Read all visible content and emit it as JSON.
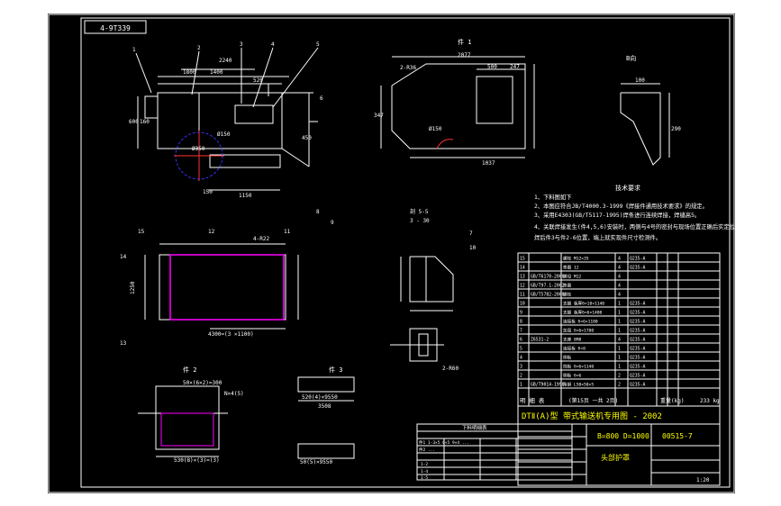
{
  "drawing": {
    "stamp": "4-9T339",
    "views": {
      "view1": "件 1",
      "view2": "件 2",
      "view3": "件 3",
      "section_b": "B向",
      "section_a": "A向",
      "section_sub": "3 - 30",
      "detail_6": "6 - 0/8",
      "section_5": "剖 5-5"
    },
    "balloons": [
      "1",
      "2",
      "3",
      "4",
      "5",
      "6",
      "7",
      "8",
      "9",
      "10",
      "11",
      "12",
      "13",
      "14",
      "15"
    ],
    "dims": {
      "d2240": "2240",
      "d1400": "1400",
      "d1800": "1800",
      "d520": "520",
      "d160": "160",
      "d600": "600",
      "d450": "450",
      "d150": "150",
      "d1150": "1150",
      "d2077": "2077",
      "d500": "500",
      "d247": "247",
      "d1037": "1037",
      "d347": "347",
      "d160b": "160",
      "d100": "100",
      "d290": "290",
      "d1250": "1250",
      "d4300": "4300=(3 ×1100)",
      "d3060": "3060",
      "d5000": "50×(6×2)=300",
      "d530": "530(8)×(3)=(3)",
      "d9550": "520(4)×9550",
      "d3508": "3508",
      "d5630": "50(5)×9550",
      "dN": "N×4(5)",
      "d2r": "2-R36",
      "d4r": "4-R22",
      "dphi": "Ø350",
      "dphi2": "Ø150",
      "d2r60": "2-R60"
    }
  },
  "notes": {
    "title": "技术要求",
    "items": [
      "1、下料图如下",
      "2、本图应符合JB/T4000.3-1999《焊接件通用技术要求》的规定。",
      "3、采用E4303(GB/T5117-1995)焊条进行连续焊接，焊缝高5。",
      "4、关联焊接发生(件4,5,6)安装时，两侧与4号的密封与现场位置正确后实定位焊接，",
      "   焊后件3与件2-6位置，端上就实现件尺寸检测件。"
    ]
  },
  "bom": {
    "rows": [
      [
        "15",
        "",
        "螺栓 M12×35",
        "4",
        "Q235-A",
        "",
        ""
      ],
      [
        "14",
        "",
        "垫圈 12",
        "4",
        "Q235-A",
        "",
        ""
      ],
      [
        "13",
        "GB/T6170-2000",
        "螺母 M12",
        "4",
        "",
        "",
        ""
      ],
      [
        "12",
        "GB/T97.1-2002",
        "垫圈",
        "4",
        "",
        "",
        ""
      ],
      [
        "11",
        "GB/T5782-2000",
        "螺栓",
        "4",
        "",
        "",
        ""
      ],
      [
        "10",
        "",
        "支腿 板厚δ=10×1140",
        "1",
        "Q235-A",
        "",
        ""
      ],
      [
        "9",
        "",
        "支腿 板厚δ=6×1400",
        "1",
        "Q235-A",
        "",
        ""
      ],
      [
        "8",
        "",
        "连接板 δ=6×1180",
        "1",
        "Q235-A",
        "",
        ""
      ],
      [
        "7",
        "",
        "加强 δ=6×1780",
        "1",
        "Q235-A",
        "",
        ""
      ],
      [
        "6",
        "Z6531-2",
        "支座 8M8",
        "4",
        "Q235-A",
        "",
        ""
      ],
      [
        "5",
        "",
        "连接板 δ=8",
        "1",
        "Q235-A",
        "",
        ""
      ],
      [
        "4",
        "",
        "侧板",
        "1",
        "Q235-A",
        "",
        ""
      ],
      [
        "3",
        "",
        "挡板 δ=6×1140",
        "1",
        "Q235-A",
        "",
        ""
      ],
      [
        "2",
        "",
        "侧板 δ=6",
        "2",
        "Q235-A",
        "",
        ""
      ],
      [
        "1",
        "GB/T9014-1998",
        "角钢 L50×50×5",
        "2",
        "Q235-A",
        "",
        ""
      ]
    ],
    "header": [
      "序 号",
      "代 号",
      "名 称",
      "数量",
      "材 料",
      "单件",
      "总计"
    ],
    "footer_left": "明 细 表",
    "footer_mid": "(第15页 一共 2页)",
    "footer_right": "重量(kg)",
    "footer_val": "233 kg"
  },
  "title_block": {
    "main": "DTⅡ(A)型  带式输送机专用图 - 2002",
    "spec": "B=800 D=1000",
    "code": "00515-7",
    "part": "头部护罩",
    "scale": "1:20"
  },
  "cut_table": {
    "title": "下料明细表",
    "rows": [
      [
        "件1 1-3×5 6×5 9×4 ...",
        "..."
      ],
      [
        "件2 ...",
        "..."
      ],
      [
        "1-2",
        "4×6",
        "...",
        "..."
      ],
      [
        "1-4",
        "4×6",
        "...",
        "..."
      ],
      [
        "1-5",
        "4×6",
        "...",
        "..."
      ]
    ]
  }
}
